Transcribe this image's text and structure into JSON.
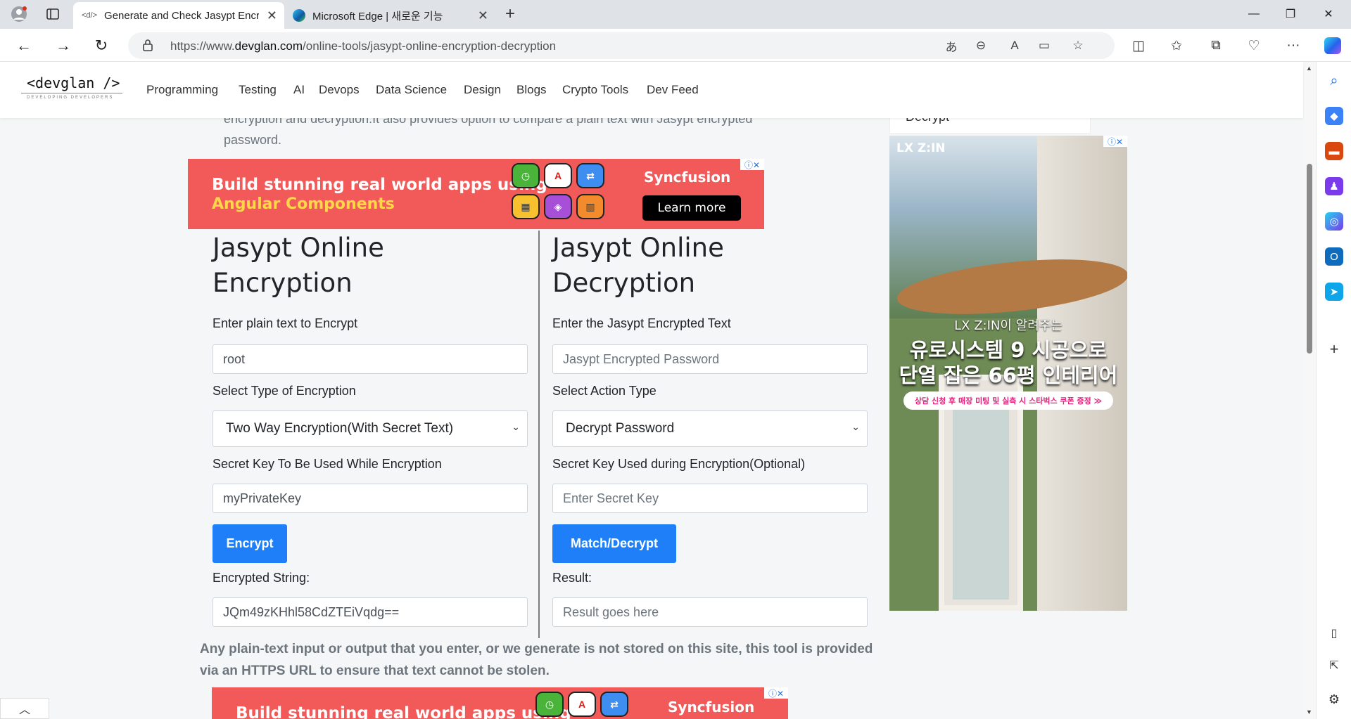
{
  "browser": {
    "tabs": [
      {
        "title": "Generate and Check Jasypt Encryption",
        "icon": "code-icon",
        "active": true
      },
      {
        "title": "Microsoft Edge | 새로운 기능",
        "icon": "edge-icon",
        "active": false
      }
    ],
    "new_tab_label": "+",
    "url_prefix": "https://www.",
    "url_domain": "devglan.com",
    "url_path": "/online-tools/jasypt-online-encryption-decryption"
  },
  "site": {
    "logo_text": "<devglan   />",
    "logo_tagline": "DEVELOPING DEVELOPERS",
    "menu": [
      "Programming",
      "Testing",
      "AI",
      "Devops",
      "Data Science",
      "Design",
      "Blogs",
      "Crypto Tools",
      "Dev Feed"
    ]
  },
  "intro": {
    "line1": "encryption and decryption.It also provides option to compare a plain text with Jasypt encrypted",
    "line2": "password."
  },
  "ad_top": {
    "line1": "Build stunning real world apps using",
    "line2": "Angular Components",
    "brand": "Syncfusion",
    "cta": "Learn more"
  },
  "ad_bottom": {
    "line1": "Build stunning real world apps using",
    "brand": "Syncfusion"
  },
  "encryption": {
    "title_line1": "Jasypt Online",
    "title_line2": "Encryption",
    "plain_label": "Enter plain text to Encrypt",
    "plain_value": "root",
    "type_label": "Select Type of Encryption",
    "type_value": "Two Way Encryption(With Secret Text)",
    "key_label": "Secret Key To Be Used While Encryption",
    "key_value": "myPrivateKey",
    "button": "Encrypt",
    "result_label": "Encrypted String:",
    "result_value": "JQm49zKHhl58CdZTEiVqdg=="
  },
  "decryption": {
    "title_line1": "Jasypt Online",
    "title_line2": "Decryption",
    "enc_label": "Enter the Jasypt Encrypted Text",
    "enc_placeholder": "Jasypt Encrypted Password",
    "action_label": "Select Action Type",
    "action_value": "Decrypt Password",
    "key_label": "Secret Key Used during Encryption(Optional)",
    "key_placeholder": "Enter Secret Key",
    "button": "Match/Decrypt",
    "result_label": "Result:",
    "result_placeholder": "Result goes here"
  },
  "disclaimer": {
    "line1": "Any plain-text input or output that you enter, or we generate is not stored on this site, this tool is provided",
    "line2": "via an HTTPS URL to ensure that text cannot be stolen."
  },
  "sidebar_snippet": "Decrypt",
  "right_ad": {
    "brand": "LX Z:IN",
    "line1": "LX Z:IN이 알려주는",
    "line2": "유로시스템 9 시공으로",
    "line3": "단열 잡은 66평 인테리어",
    "pill": "상담 신청 후 매장 미팅 및 실측 시 스타벅스 쿠폰 증정 ≫"
  },
  "colors": {
    "primary_button": "#1e7ff8",
    "ad_red": "#f25959",
    "ad_yellow": "#ffd84a"
  }
}
